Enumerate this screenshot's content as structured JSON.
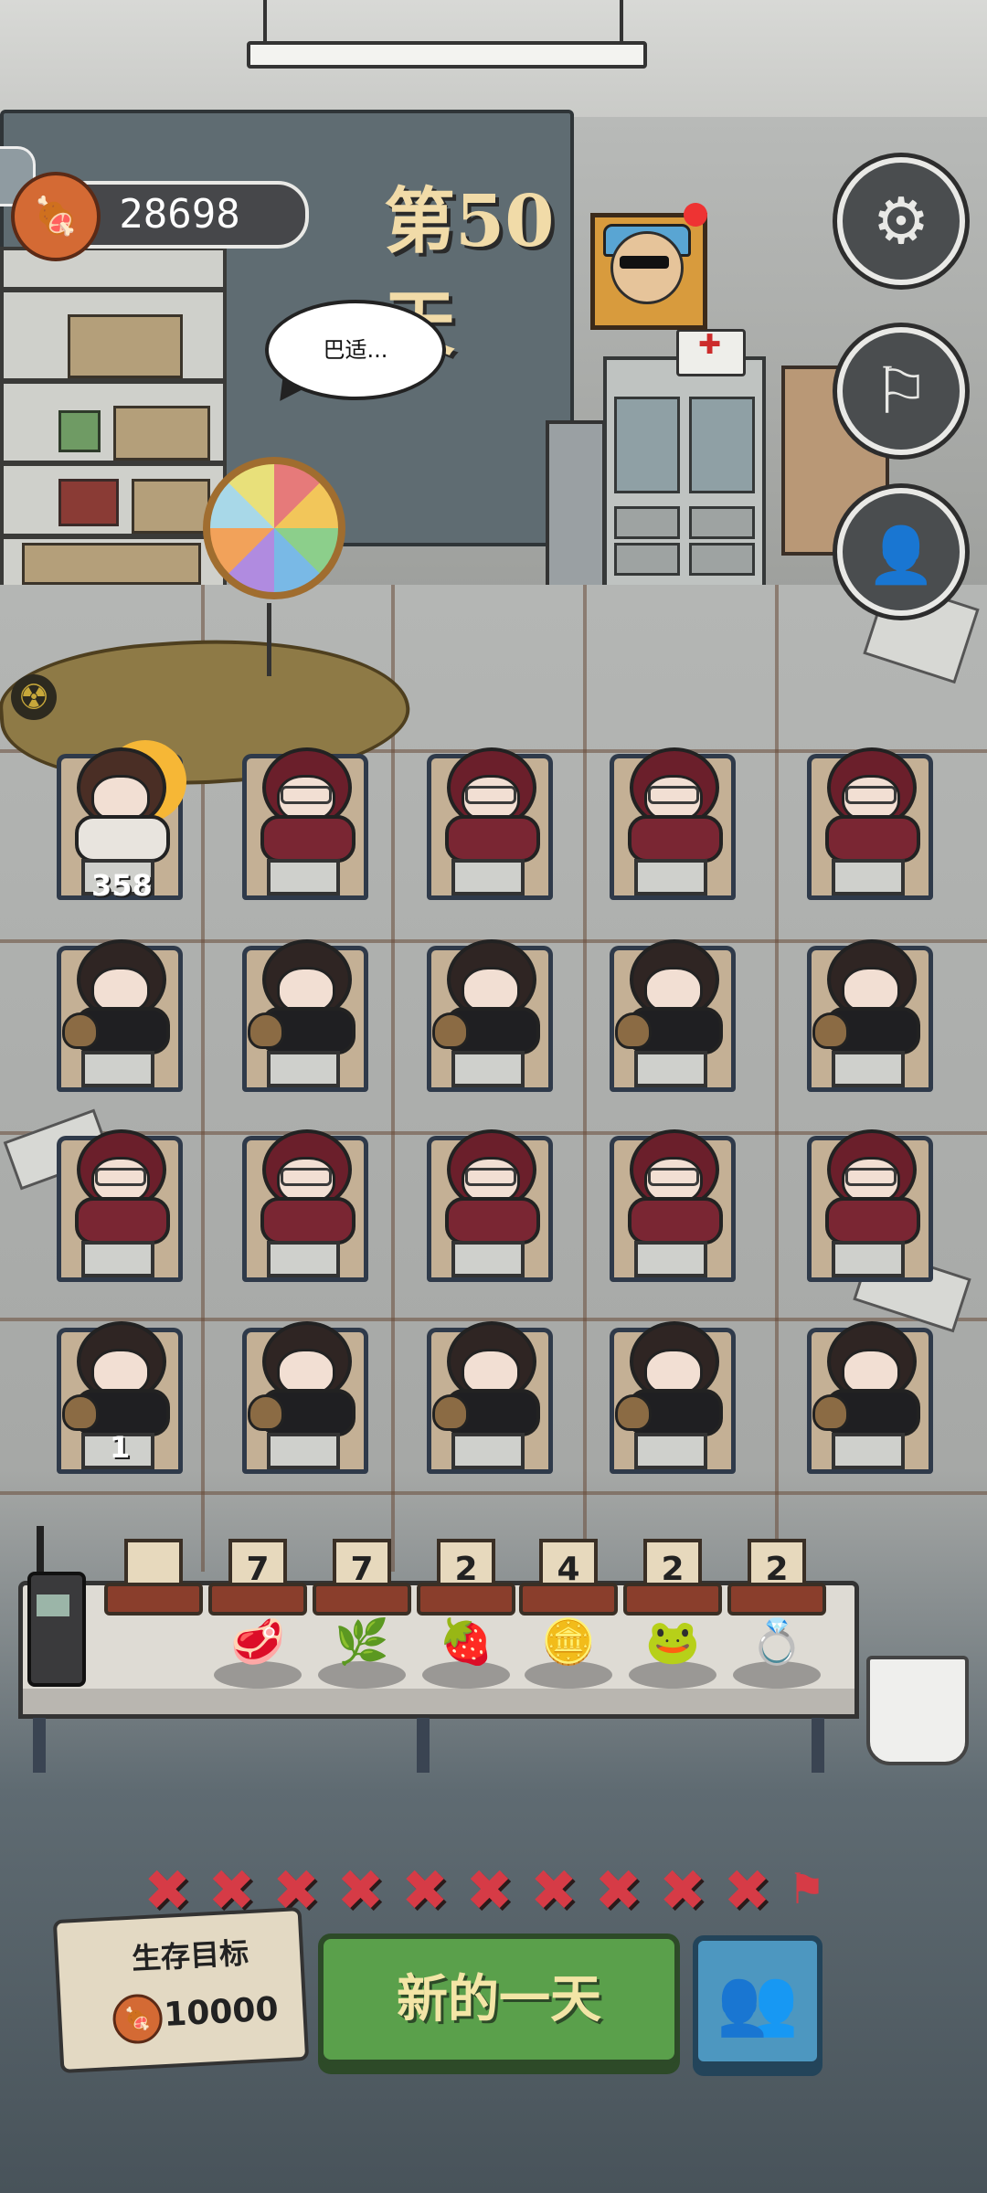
{
  "hud": {
    "meat_count": "28698",
    "day_label": "第50天",
    "speech_bubble": "巴适..."
  },
  "icons": {
    "meat": "meat-icon",
    "settings": "gear-icon",
    "flag": "flag-icon",
    "profile_search": "user-search-icon",
    "pause": "pause-icon",
    "group": "group-icon"
  },
  "grid": {
    "first_counter": "358",
    "last_row_first_counter": "1",
    "rows": [
      [
        "boy",
        "hood",
        "hood",
        "hood",
        "hood"
      ],
      [
        "pony",
        "pony",
        "pony",
        "pony",
        "pony"
      ],
      [
        "hood",
        "hood",
        "hood",
        "hood",
        "hood"
      ],
      [
        "pony",
        "pony",
        "pony",
        "pony",
        "pony"
      ]
    ]
  },
  "items": [
    {
      "name": "empty",
      "count": "",
      "icon": ""
    },
    {
      "name": "meat-pieces",
      "count": "7",
      "icon": "🥩"
    },
    {
      "name": "herb",
      "count": "7",
      "icon": "🌿"
    },
    {
      "name": "red-pinecone",
      "count": "2",
      "icon": "🍓"
    },
    {
      "name": "gold-nugget",
      "count": "4",
      "icon": "🪙"
    },
    {
      "name": "frog",
      "count": "2",
      "icon": "🐸"
    },
    {
      "name": "ring-box",
      "count": "2",
      "icon": "💍"
    }
  ],
  "progress": {
    "failed_marks": 10,
    "mark_glyph": "✖",
    "end_glyph": "⚑"
  },
  "goal": {
    "title": "生存目标",
    "value": "10000"
  },
  "buttons": {
    "new_day": "新的一天"
  },
  "colors": {
    "accent_green": "#5aa04b",
    "accent_blue": "#4d97c0",
    "mark_red": "#d63b46"
  }
}
